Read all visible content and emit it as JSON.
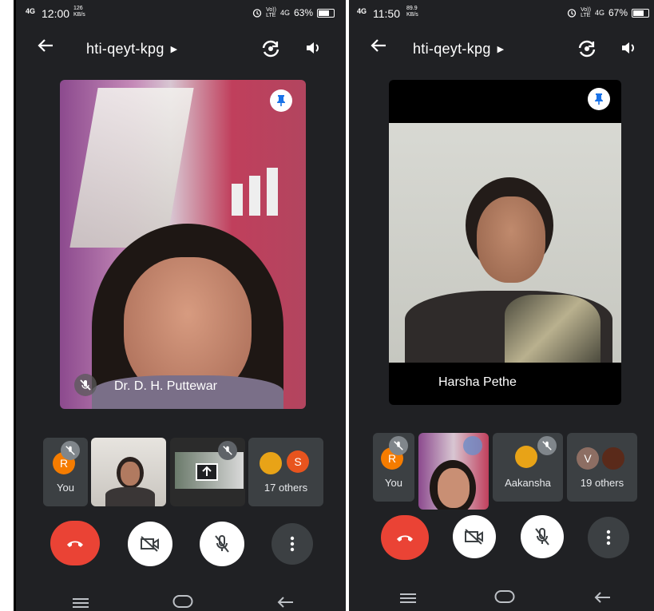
{
  "left": {
    "status": {
      "network": "4G",
      "time": "12:00",
      "speed": "126\nKB/s",
      "volte": "Vo))\nLTE",
      "net2": "4G",
      "battery": "63%",
      "battery_level": 0.63
    },
    "header": {
      "meeting_code": "hti-qeyt-kpg"
    },
    "main_speaker": {
      "name": "Dr. D. H. Puttewar"
    },
    "participants": [
      {
        "label": "You",
        "avatar": "R"
      },
      {
        "label": ""
      },
      {
        "label": ""
      },
      {
        "label": "17 others",
        "avatar": "S"
      }
    ]
  },
  "right": {
    "status": {
      "network": "4G",
      "time": "11:50",
      "speed": "89.9\nKB/s",
      "volte": "Vo))\nLTE",
      "net2": "4G",
      "battery": "67%",
      "battery_level": 0.67
    },
    "header": {
      "meeting_code": "hti-qeyt-kpg"
    },
    "main_speaker": {
      "name": "Harsha Pethe"
    },
    "participants": [
      {
        "label": "You",
        "avatar": "R"
      },
      {
        "label": ""
      },
      {
        "label": "Aakansha"
      },
      {
        "label": "19 others",
        "avatar": "V"
      }
    ]
  },
  "colors": {
    "background": "#202124",
    "tile": "#3c4043",
    "end_call": "#ea4335",
    "pin": "#1a73e8",
    "avatar_orange": "#f57c00",
    "avatar_red": "#e8541e",
    "avatar_brown": "#8d6e63"
  },
  "icons": [
    "back-arrow-icon",
    "switch-camera-icon",
    "speaker-icon",
    "pin-icon",
    "mic-off-icon",
    "present-screen-icon",
    "end-call-icon",
    "camera-off-icon",
    "more-vert-icon",
    "menu-icon",
    "home-icon",
    "nav-back-icon"
  ]
}
